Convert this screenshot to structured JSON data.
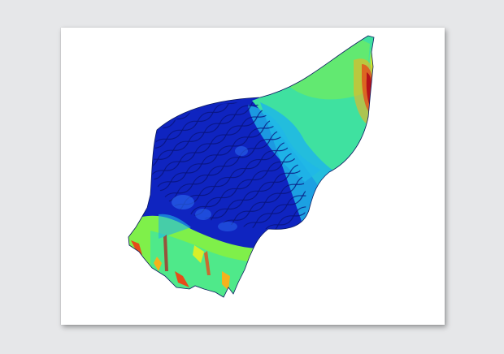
{
  "figure": {
    "background_color": "#e6e7e9",
    "paper_color": "#ffffff",
    "colormap": [
      "#0a1fb0",
      "#1f57e0",
      "#1fb6e8",
      "#3be6a5",
      "#7ff04a",
      "#d7ef2a",
      "#f5b21c",
      "#e54c1a",
      "#b5121a"
    ]
  }
}
